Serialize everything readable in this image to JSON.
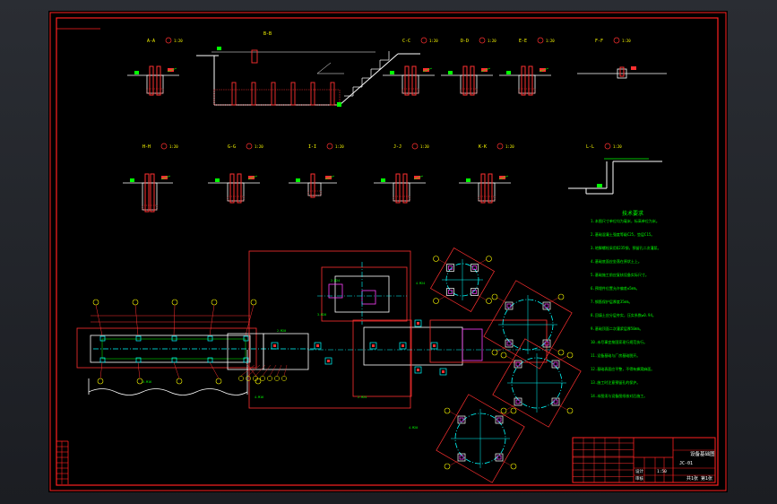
{
  "colors": {
    "background": "#000000",
    "border": "#ff2020",
    "line": "#ffffff",
    "dimension": "#00ff00",
    "annotation": "#ffff00",
    "foundation": "#ff3030",
    "axis": "#00ffff",
    "pier": "#ff40ff"
  },
  "sections": [
    {
      "id": "aa",
      "title": "A-A",
      "scale": "1:20"
    },
    {
      "id": "bb",
      "title": "B-B",
      "scale": ""
    },
    {
      "id": "cc",
      "title": "C-C",
      "scale": "1:20"
    },
    {
      "id": "dd",
      "title": "D-D",
      "scale": "1:20"
    },
    {
      "id": "ee",
      "title": "E-E",
      "scale": "1:20"
    },
    {
      "id": "ff",
      "title": "F-F",
      "scale": "1:20"
    },
    {
      "id": "hh",
      "title": "H-H",
      "scale": "1:20"
    },
    {
      "id": "gg",
      "title": "G-G",
      "scale": "1:20"
    },
    {
      "id": "ii",
      "title": "I-I",
      "scale": "1:20"
    },
    {
      "id": "jj",
      "title": "J-J",
      "scale": "1:20"
    },
    {
      "id": "kk",
      "title": "K-K",
      "scale": "1:20"
    },
    {
      "id": "ll",
      "title": "L-L",
      "scale": "1:20"
    }
  ],
  "notes": {
    "heading": "技术要求",
    "lines": [
      "1.本图尺寸单位均为毫米，标高单位为米。",
      "2.基础混凝土强度等级C25，垫层C15。",
      "3.地脚螺栓采用Q235钢，预留孔二次灌浆。",
      "4.基础底面应坐落在原状土上。",
      "5.基础施工前应复核设备实际尺寸。",
      "6.预埋件位置允许偏差±5mm。",
      "7.钢筋保护层厚度35mm。",
      "8.回填土应分层夯实，压实系数≥0.94。",
      "9.基础顶面二次灌浆层厚50mm。",
      "10.未尽事宜按国家现行规范执行。",
      "11.设备基础与厂房基础脱开。",
      "12.基础表面应平整，不得有蜂窝麻面。",
      "13.施工时注意预留孔的保护。",
      "14.本图须与设备图纸核对后施工。"
    ]
  },
  "title_block": {
    "title": "设备基础图",
    "drawing_no": "JC-01",
    "scale": "1:50",
    "sheet": "共1张 第1张",
    "designer": "设计",
    "checker": "审核"
  }
}
